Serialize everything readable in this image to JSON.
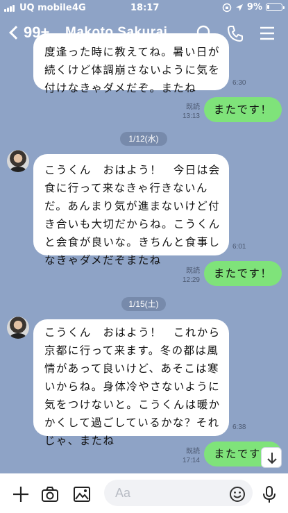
{
  "status": {
    "carrier": "UQ mobile",
    "network": "4G",
    "time": "18:17",
    "battery": "9%"
  },
  "header": {
    "unread_count": "99+",
    "contact_name": "Makoto Sakurai",
    "icons": [
      "search-icon",
      "phone-icon",
      "menu-icon"
    ]
  },
  "messages": {
    "m1": {
      "lines": [
        "度逢った時に教えてね。暑い日が",
        "続くけど体調崩さないように気を",
        "付けなきゃダメだぞ。またね"
      ],
      "time": "6:30"
    },
    "r1": {
      "text": "またです！",
      "read": "既読",
      "time": "13:13"
    },
    "d1": "1/12(水)",
    "m2": {
      "lines": [
        "こうくん　おはよう！　今日は会",
        "食に行って来なきゃ行きないん",
        "だ。あんまり気が進まないけど付",
        "き合いも大切だからね。こうくん",
        "と会食が良いな。きちんと食事し",
        "なきゃダメだぞまたね"
      ],
      "time": "6:01"
    },
    "r2": {
      "text": "またです！",
      "read": "既読",
      "time": "12:29"
    },
    "d2": "1/15(土)",
    "m3": {
      "lines": [
        "こうくん　おはよう！　これから",
        "京都に行って来ます。冬の都は風",
        "情があって良いけど、あそこは寒",
        "いからね。身体冷やさないように",
        "気をつけないと。こうくんは暖か",
        "かくして過ごしているかな？それ",
        "じゃ、またね"
      ],
      "time": "6:38"
    },
    "r3": {
      "text": "またです！",
      "read": "既読",
      "time": "17:14"
    }
  },
  "composer": {
    "placeholder": "Aa",
    "icons": [
      "plus-icon",
      "camera-icon",
      "image-icon",
      "emoji-icon",
      "mic-icon"
    ]
  },
  "colors": {
    "background": "#8ea3c6",
    "sent_bubble": "#7fe37a",
    "received_bubble": "#ffffff"
  }
}
